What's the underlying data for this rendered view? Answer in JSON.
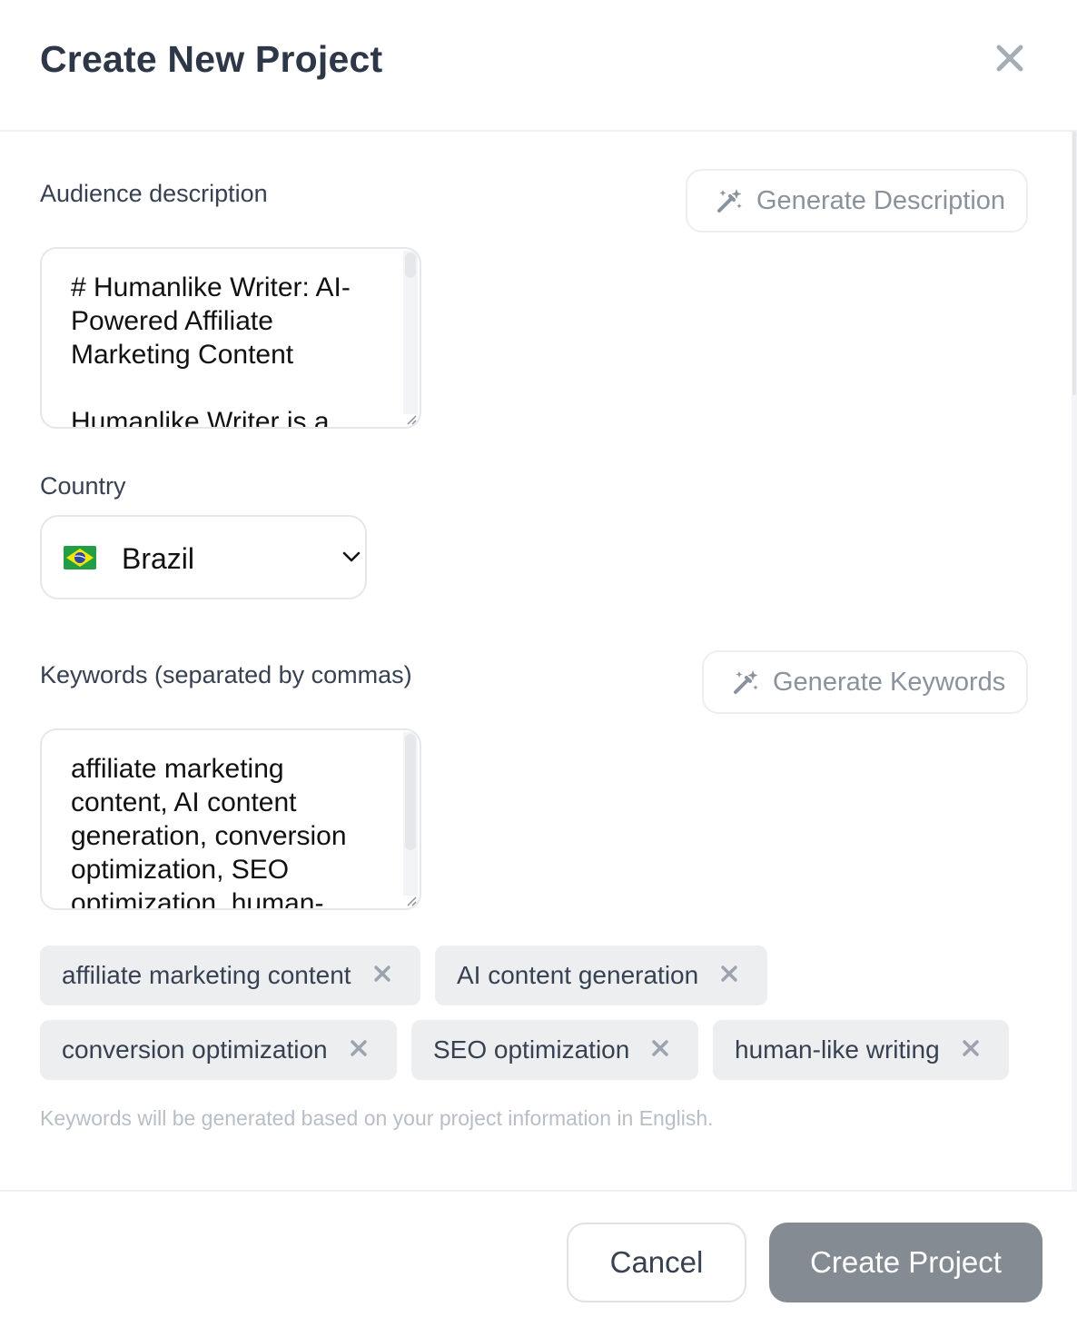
{
  "modal": {
    "title": "Create New Project"
  },
  "audience": {
    "label": "Audience description",
    "generate_label": "Generate Description",
    "value": "# Humanlike Writer: AI-\nPowered Affiliate\nMarketing Content\n\nHumanlike Writer is a"
  },
  "country": {
    "label": "Country",
    "value": "Brazil",
    "flag_icon": "brazil-flag-icon"
  },
  "keywords": {
    "label": "Keywords (separated by commas)",
    "generate_label": "Generate Keywords",
    "value": "affiliate marketing\ncontent, AI content\ngeneration, conversion\noptimization, SEO\noptimization, human-",
    "chips": [
      "affiliate marketing content",
      "AI content generation",
      "conversion optimization",
      "SEO optimization",
      "human-like writing"
    ],
    "hint": "Keywords will be generated based on your project information in English."
  },
  "footer": {
    "cancel_label": "Cancel",
    "create_label": "Create Project"
  },
  "colors": {
    "primary_disabled": "#858b93",
    "chip_bg": "#eceef0",
    "hint_text": "#b8bec6"
  }
}
